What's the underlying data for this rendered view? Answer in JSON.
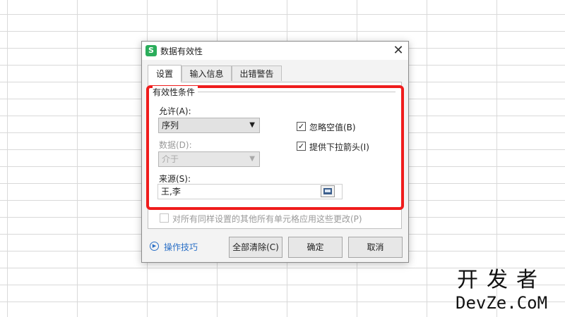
{
  "dialog": {
    "app_icon_letter": "S",
    "title": "数据有效性",
    "close_glyph": "✕",
    "tabs": [
      "设置",
      "输入信息",
      "出错警告"
    ],
    "group_title": "有效性条件",
    "allow": {
      "label": "允许(A):",
      "value": "序列"
    },
    "data": {
      "label": "数据(D):",
      "value": "介于"
    },
    "ignore_blank": {
      "label": "忽略空值(B)",
      "checked": true
    },
    "dropdown_arrow": {
      "label": "提供下拉箭头(I)",
      "checked": true
    },
    "source": {
      "label": "来源(S):",
      "value": "王,李"
    },
    "apply_all": {
      "label": "对所有同样设置的其他所有单元格应用这些更改(P)",
      "checked": false
    },
    "help_link": "操作技巧",
    "buttons": {
      "clear_all": "全部清除(C)",
      "ok": "确定",
      "cancel": "取消"
    },
    "check_glyph": "✓",
    "arrow_glyph": "▼"
  },
  "watermark": {
    "cn": "开发者",
    "en": "DevZe.CoM"
  },
  "colors": {
    "highlight": "#ef1c1c",
    "app_icon": "#2bad5b",
    "link": "#2a6fc6"
  }
}
